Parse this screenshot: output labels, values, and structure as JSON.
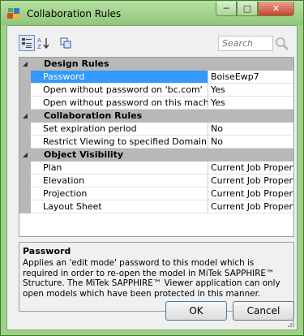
{
  "window": {
    "title": "Collaboration Rules"
  },
  "toolbar": {
    "search_placeholder": "Search"
  },
  "grid": {
    "categories": [
      {
        "label": "Design Rules",
        "rows": [
          {
            "name": "Password",
            "value": "BoiseEwp7"
          },
          {
            "name": "Open without password on 'bc.com'",
            "value": "Yes"
          },
          {
            "name": "Open without password on this machine",
            "value": "Yes"
          }
        ]
      },
      {
        "label": "Collaboration Rules",
        "rows": [
          {
            "name": "Set expiration period",
            "value": "No"
          },
          {
            "name": "Restrict Viewing to specified Domain",
            "value": "No"
          }
        ]
      },
      {
        "label": "Object Visibility",
        "rows": [
          {
            "name": "Plan",
            "value": "Current Job Properties"
          },
          {
            "name": "Elevation",
            "value": "Current Job Properties"
          },
          {
            "name": "Projection",
            "value": "Current Job Properties"
          },
          {
            "name": "Layout Sheet",
            "value": "Current Job Properties"
          }
        ]
      }
    ]
  },
  "description": {
    "title": "Password",
    "text": "Applies an 'edit mode' password to this model which is required in order to re-open the model in MiTek SAPPHIRE™ Structure. The MiTek SAPPHIRE™ Viewer application can only open models which have been protected in this manner."
  },
  "buttons": {
    "ok": "OK",
    "cancel": "Cancel"
  },
  "colors": {
    "titlebar": "#9ed08a",
    "selection": "#3399ff",
    "category": "#b8b8b8"
  }
}
